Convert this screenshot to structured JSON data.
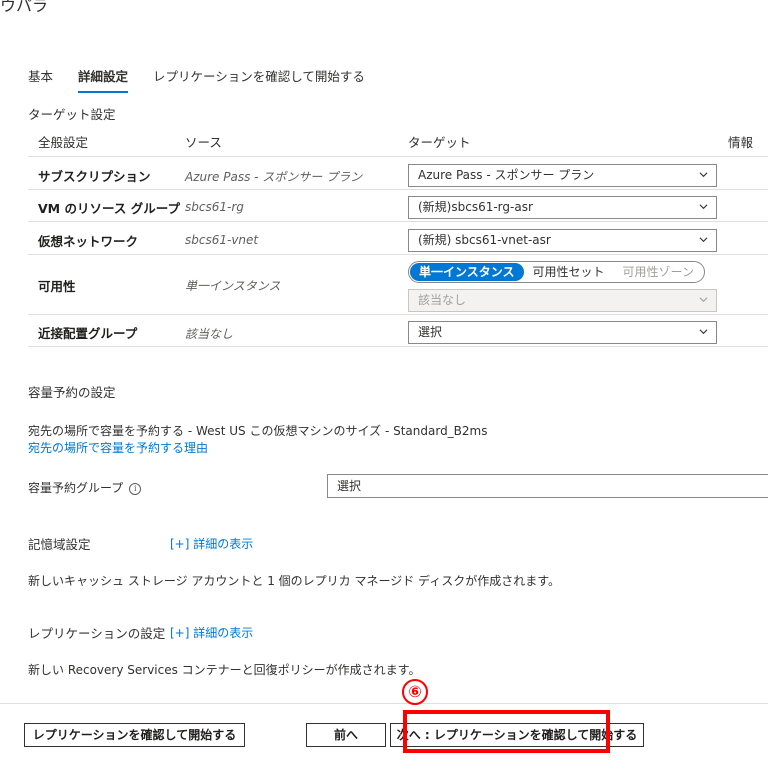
{
  "page": {
    "title_fragment": "ウパラ"
  },
  "tabs": [
    {
      "label": "基本",
      "active": false
    },
    {
      "label": "詳細設定",
      "active": true
    },
    {
      "label": "レプリケーションを確認して開始する",
      "active": false
    }
  ],
  "target_settings": {
    "heading": "ターゲット設定",
    "columns": {
      "general": "全般設定",
      "source": "ソース",
      "target": "ターゲット",
      "info": "情報"
    },
    "rows": [
      {
        "label": "サブスクリプション",
        "source": "Azure Pass - スポンサー プラン",
        "target": "Azure Pass - スポンサー プラン"
      },
      {
        "label": "VM のリソース グループ",
        "source": "sbcs61-rg",
        "target": "(新規)sbcs61-rg-asr"
      },
      {
        "label": "仮想ネットワーク",
        "source": "sbcs61-vnet",
        "target": "(新規) sbcs61-vnet-asr"
      },
      {
        "label": "可用性",
        "source": "単一インスタンス",
        "options": [
          "単一インスタンス",
          "可用性セット",
          "可用性ゾーン"
        ],
        "selected_option": "単一インスタンス",
        "sub_select": "該当なし"
      },
      {
        "label": "近接配置グループ",
        "source": "該当なし",
        "target": "選択"
      }
    ]
  },
  "capacity": {
    "heading": "容量予約の設定",
    "description": "宛先の場所で容量を予約する - West US この仮想マシンのサイズ - Standard_B2ms",
    "link": "宛先の場所で容量を予約する理由",
    "group_label": "容量予約グループ",
    "group_value": "選択"
  },
  "storage": {
    "heading": "記憶域設定",
    "link": "[+] 詳細の表示",
    "description": "新しいキャッシュ ストレージ アカウントと 1 個のレプリカ マネージド ディスクが作成されます。"
  },
  "replication": {
    "heading": "レプリケーションの設定",
    "link": "[+] 詳細の表示",
    "description": "新しい Recovery Services コンテナーと回復ポリシーが作成されます。"
  },
  "footer": {
    "review_button": "レプリケーションを確認して開始する",
    "prev_button": "前へ",
    "next_button": "次へ : レプリケーションを確認して開始する"
  },
  "annotation": {
    "step_number": "⑥",
    "highlight_color": "#ff0000"
  },
  "colors": {
    "accent": "#0078d4",
    "border": "#8a8886"
  }
}
